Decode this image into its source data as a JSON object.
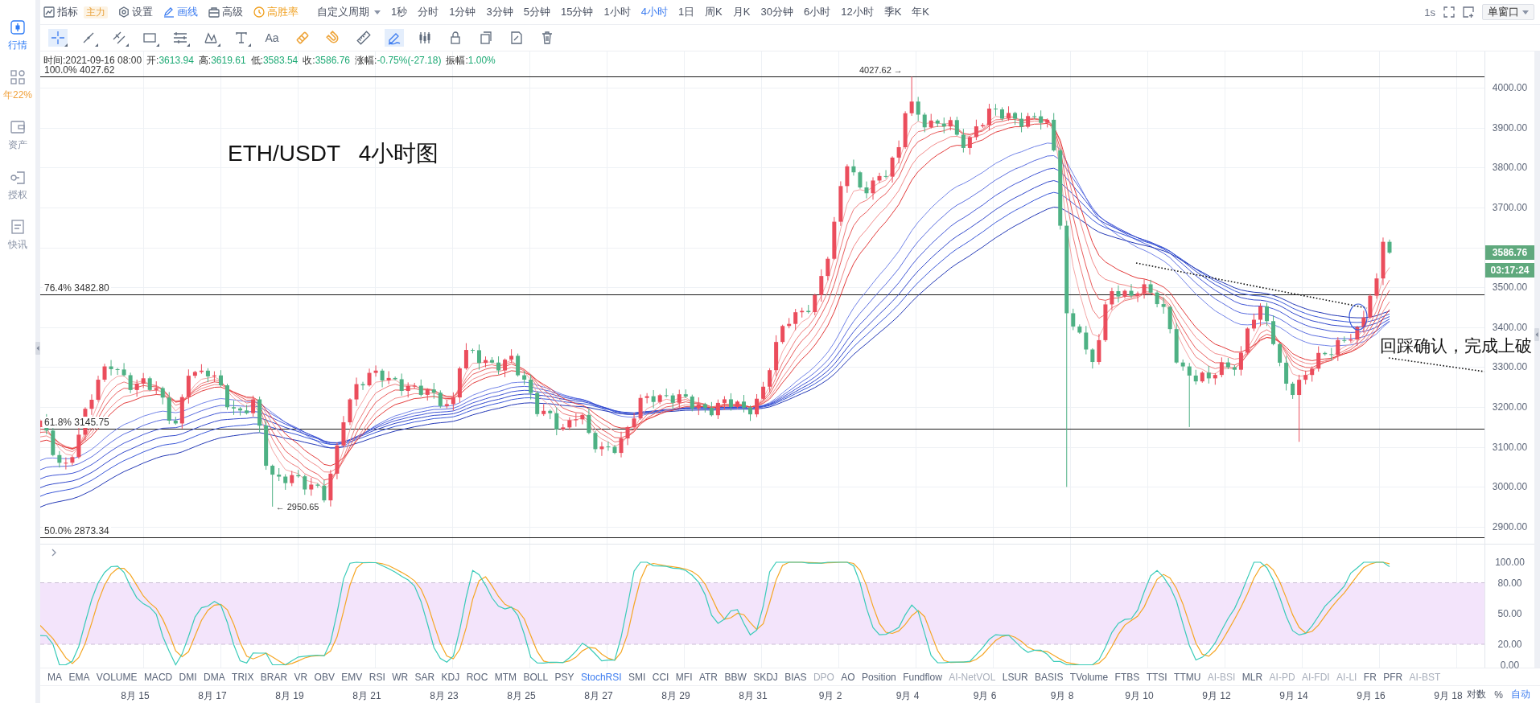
{
  "sidebar": {
    "items": [
      {
        "label": "行情",
        "selected": true,
        "kind": "nav"
      },
      {
        "label": "年22%",
        "selected": false,
        "kind": "promo"
      },
      {
        "label": "资产",
        "selected": false,
        "kind": "nav"
      },
      {
        "label": "授权",
        "selected": false,
        "kind": "nav"
      },
      {
        "label": "快讯",
        "selected": false,
        "kind": "nav"
      }
    ]
  },
  "toolbar": {
    "menus": [
      {
        "label": "指标",
        "badge": "主力",
        "active": false,
        "kind": "plain"
      },
      {
        "label": "设置",
        "active": false,
        "kind": "plain"
      },
      {
        "label": "画线",
        "active": true,
        "kind": "plain"
      },
      {
        "label": "高级",
        "active": false,
        "kind": "plain"
      },
      {
        "label": "高胜率",
        "active": false,
        "kind": "promo"
      }
    ],
    "custom_period": "自定义周期",
    "periods": [
      {
        "label": "1秒",
        "selected": false
      },
      {
        "label": "分时",
        "selected": false
      },
      {
        "label": "1分钟",
        "selected": false
      },
      {
        "label": "3分钟",
        "selected": false
      },
      {
        "label": "5分钟",
        "selected": false
      },
      {
        "label": "15分钟",
        "selected": false
      },
      {
        "label": "1小时",
        "selected": false
      },
      {
        "label": "4小时",
        "selected": true
      },
      {
        "label": "1日",
        "selected": false
      },
      {
        "label": "周K",
        "selected": false
      },
      {
        "label": "月K",
        "selected": false
      },
      {
        "label": "30分钟",
        "selected": false
      },
      {
        "label": "6小时",
        "selected": false
      },
      {
        "label": "12小时",
        "selected": false
      },
      {
        "label": "季K",
        "selected": false
      },
      {
        "label": "年K",
        "selected": false
      }
    ],
    "refresh": "1s",
    "layout_button": "单窗口"
  },
  "drawing_tools": [
    {
      "selected": true,
      "on": false,
      "menu": true
    },
    {
      "selected": false,
      "on": false,
      "menu": true
    },
    {
      "selected": false,
      "on": false,
      "menu": true
    },
    {
      "selected": false,
      "on": false,
      "menu": true
    },
    {
      "selected": false,
      "on": false,
      "menu": true
    },
    {
      "selected": false,
      "on": false,
      "menu": true
    },
    {
      "selected": false,
      "on": false,
      "menu": true
    },
    {
      "label": "Aa",
      "selected": false,
      "on": false,
      "menu": false
    },
    {
      "selected": false,
      "on": true,
      "menu": false
    },
    {
      "selected": false,
      "on": true,
      "menu": false
    },
    {
      "selected": false,
      "on": false,
      "menu": false
    },
    {
      "selected": true,
      "on": false,
      "menu": false
    },
    {
      "selected": false,
      "on": false,
      "menu": false
    },
    {
      "selected": false,
      "on": false,
      "menu": false
    },
    {
      "selected": false,
      "on": false,
      "menu": false
    },
    {
      "selected": false,
      "on": false,
      "menu": false
    },
    {
      "selected": false,
      "on": false,
      "menu": false
    }
  ],
  "info": {
    "time": "时间:2021-09-16 08:00",
    "fields": [
      {
        "label": "开:",
        "value": "3613.94"
      },
      {
        "label": "高:",
        "value": "3619.61"
      },
      {
        "label": "低:",
        "value": "3583.54"
      },
      {
        "label": "收:",
        "value": "3586.76"
      },
      {
        "label": "涨幅:",
        "value": "-0.75%(-27.18)"
      },
      {
        "label": "振幅:",
        "value": "1.00%"
      }
    ]
  },
  "chart": {
    "title": "ETH/USDT   4小时图",
    "fib_levels": [
      {
        "label": "100.0% 4027.62"
      },
      {
        "label": "76.4% 3482.80"
      },
      {
        "label": "61.8% 3145.75"
      },
      {
        "label": "50.0% 2873.34"
      }
    ],
    "high_marker": "4027.62 →",
    "low_marker": "← 2950.65",
    "note": "回踩确认，完成上破",
    "price_ticks_upper": [
      "4000.00",
      "3900.00",
      "3800.00",
      "3700.00"
    ],
    "last_price": "3586.76",
    "countdown": "03:17:24",
    "price_ticks_lower": [
      "3500.00",
      "3400.00",
      "3300.00",
      "3200.00",
      "3100.00",
      "3000.00",
      "2900.00"
    ]
  },
  "oscillator": {
    "ticks": [
      "100.00",
      "80.00",
      "50.00",
      "20.00",
      "0.00"
    ]
  },
  "indicators": [
    {
      "label": "MA",
      "selected": false,
      "disabled": false
    },
    {
      "label": "EMA",
      "selected": false,
      "disabled": false
    },
    {
      "label": "VOLUME",
      "selected": false,
      "disabled": false
    },
    {
      "label": "MACD",
      "selected": false,
      "disabled": false
    },
    {
      "label": "DMI",
      "selected": false,
      "disabled": false
    },
    {
      "label": "DMA",
      "selected": false,
      "disabled": false
    },
    {
      "label": "TRIX",
      "selected": false,
      "disabled": false
    },
    {
      "label": "BRAR",
      "selected": false,
      "disabled": false
    },
    {
      "label": "VR",
      "selected": false,
      "disabled": false
    },
    {
      "label": "OBV",
      "selected": false,
      "disabled": false
    },
    {
      "label": "EMV",
      "selected": false,
      "disabled": false
    },
    {
      "label": "RSI",
      "selected": false,
      "disabled": false
    },
    {
      "label": "WR",
      "selected": false,
      "disabled": false
    },
    {
      "label": "SAR",
      "selected": false,
      "disabled": false
    },
    {
      "label": "KDJ",
      "selected": false,
      "disabled": false
    },
    {
      "label": "ROC",
      "selected": false,
      "disabled": false
    },
    {
      "label": "MTM",
      "selected": false,
      "disabled": false
    },
    {
      "label": "BOLL",
      "selected": false,
      "disabled": false
    },
    {
      "label": "PSY",
      "selected": false,
      "disabled": false
    },
    {
      "label": "StochRSI",
      "selected": true,
      "disabled": false
    },
    {
      "label": "SMI",
      "selected": false,
      "disabled": false
    },
    {
      "label": "CCI",
      "selected": false,
      "disabled": false
    },
    {
      "label": "MFI",
      "selected": false,
      "disabled": false
    },
    {
      "label": "ATR",
      "selected": false,
      "disabled": false
    },
    {
      "label": "BBW",
      "selected": false,
      "disabled": false
    },
    {
      "label": "SKDJ",
      "selected": false,
      "disabled": false
    },
    {
      "label": "BIAS",
      "selected": false,
      "disabled": false
    },
    {
      "label": "DPO",
      "selected": false,
      "disabled": true
    },
    {
      "label": "AO",
      "selected": false,
      "disabled": false
    },
    {
      "label": "Position",
      "selected": false,
      "disabled": false
    },
    {
      "label": "Fundflow",
      "selected": false,
      "disabled": false
    },
    {
      "label": "AI-NetVOL",
      "selected": false,
      "disabled": true
    },
    {
      "label": "LSUR",
      "selected": false,
      "disabled": false
    },
    {
      "label": "BASIS",
      "selected": false,
      "disabled": false
    },
    {
      "label": "TVolume",
      "selected": false,
      "disabled": false
    },
    {
      "label": "FTBS",
      "selected": false,
      "disabled": false
    },
    {
      "label": "TTSI",
      "selected": false,
      "disabled": false
    },
    {
      "label": "TTMU",
      "selected": false,
      "disabled": false
    },
    {
      "label": "AI-BSI",
      "selected": false,
      "disabled": true
    },
    {
      "label": "MLR",
      "selected": false,
      "disabled": false
    },
    {
      "label": "AI-PD",
      "selected": false,
      "disabled": true
    },
    {
      "label": "AI-FDI",
      "selected": false,
      "disabled": true
    },
    {
      "label": "AI-LI",
      "selected": false,
      "disabled": true
    },
    {
      "label": "FR",
      "selected": false,
      "disabled": false
    },
    {
      "label": "PFR",
      "selected": false,
      "disabled": false
    },
    {
      "label": "AI-BST",
      "selected": false,
      "disabled": true
    }
  ],
  "date_axis": {
    "dates": [
      "8月 15",
      "8月 17",
      "8月 19",
      "8月 21",
      "8月 23",
      "8月 25",
      "8月 27",
      "8月 29",
      "8月 31",
      "9月 2",
      "9月 4",
      "9月 6",
      "9月 8",
      "9月 10",
      "9月 12",
      "9月 14",
      "9月 16",
      "9月 18"
    ],
    "options": [
      {
        "label": "对数",
        "selected": false
      },
      {
        "label": "%",
        "selected": false
      },
      {
        "label": "自动",
        "selected": true
      }
    ]
  }
}
